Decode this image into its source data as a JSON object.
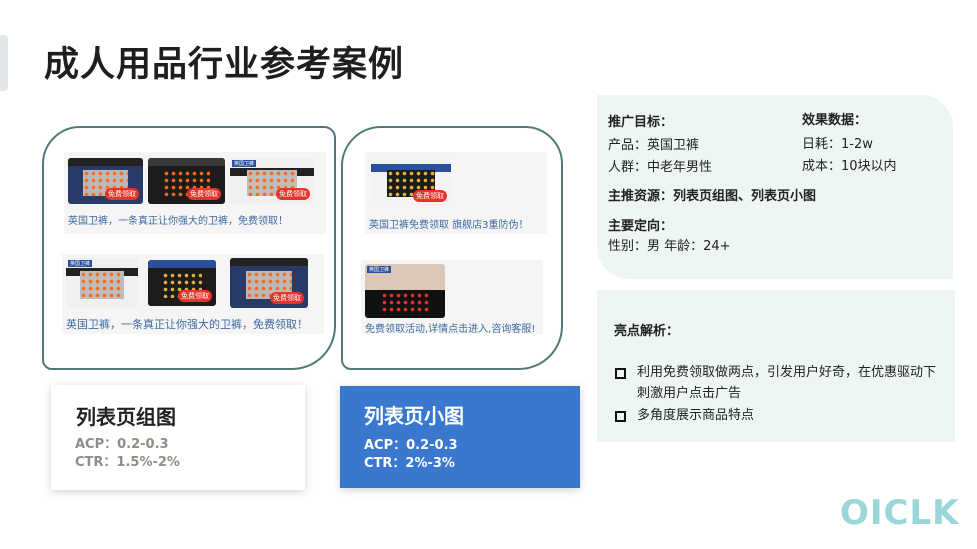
{
  "title": "成人用品行业参考案例",
  "ads": {
    "group1_caption": "英国卫裤，一条真正让你强大的卫裤，免费领取！",
    "group2_caption": "英国卫裤，一条真正让你强大的卫裤，免费领取！",
    "small1_caption": "英国卫裤免费领取 旗舰店3重防伪！",
    "small2_caption": "免费领取活动,详情点击进入,咨询客服!",
    "badge": "免费领取",
    "tag": "英国卫裤"
  },
  "cards": {
    "group": {
      "title": "列表页组图",
      "acp": "ACP：0.2-0.3",
      "ctr": "CTR：1.5%-2%"
    },
    "small": {
      "title": "列表页小图",
      "acp": "ACP：0.2-0.3",
      "ctr": "CTR：2%-3%"
    }
  },
  "info": {
    "goal_label": "推广目标：",
    "product": "产品：英国卫裤",
    "audience": "人群：中老年男性",
    "effect_label": "效果数据：",
    "daily_cost": "日耗：1-2w",
    "cost": "成本：10块以内",
    "resource": "主推资源：列表页组图、列表页小图",
    "targeting_label": "主要定向：",
    "targeting": "性别：男   年龄：24+"
  },
  "highlights": {
    "title": "亮点解析：",
    "items": [
      "利用免费领取做两点，引发用户好奇，在优惠驱动下刺激用户点击广告",
      "多角度展示商品特点"
    ]
  },
  "logo": "OICLK",
  "colors": {
    "accent_blue": "#3a78d0",
    "frame_green": "#4f7a78",
    "panel_bg": "#eef6f4",
    "logo": "#9ad7d9"
  }
}
